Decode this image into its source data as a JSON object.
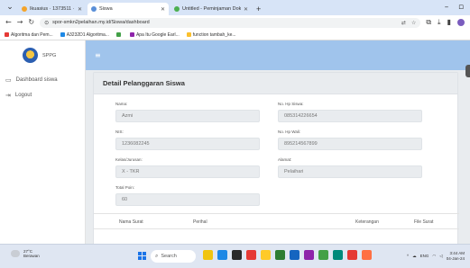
{
  "browser": {
    "tabs": [
      {
        "title": "Ikuasius · 1373511 · ids_pelat",
        "active": false,
        "favicon_color": "#f4a42b"
      },
      {
        "title": "Siswa",
        "active": true,
        "favicon_color": "#5a8fd8"
      },
      {
        "title": "Untitled - Peminjaman Dok…",
        "active": false,
        "favicon_color": "#4caf50"
      }
    ],
    "new_tab": "+",
    "url": "spor-smkn2pelaihan.my.id/Siswa/dashboard",
    "bookmarks": [
      {
        "label": "Algoritma dan Pem...",
        "color": "#e53935"
      },
      {
        "label": "A3232D1 Algoritma...",
        "color": "#1e88e5"
      },
      {
        "label": "",
        "color": "#43a047"
      },
      {
        "label": "Apa Itu Google Earl...",
        "color": "#8e24aa"
      },
      {
        "label": "function tambah_ke...",
        "color": "#fbc02d"
      }
    ]
  },
  "sidebar": {
    "brand": "SPPG",
    "items": [
      {
        "label": "Dashboard siswa",
        "icon": "monitor-icon"
      },
      {
        "label": "Logout",
        "icon": "logout-icon"
      }
    ]
  },
  "header": {
    "menu_icon": "hamburger-icon"
  },
  "card": {
    "title": "Detail Pelanggaran Siswa",
    "fields": {
      "nama": {
        "label": "Nama:",
        "value": "Azmi"
      },
      "no_hp_siswa": {
        "label": "No. Hp Siswa:",
        "value": "085314226654"
      },
      "nis": {
        "label": "NIS:",
        "value": "1236082245"
      },
      "no_hp_wali": {
        "label": "No. Hp Wali:",
        "value": "895214567899"
      },
      "kelas": {
        "label": "Kelas/Jurusan:",
        "value": "X - TKR"
      },
      "alamat": {
        "label": "Alamat:",
        "value": "Pelaihari"
      },
      "total_poin": {
        "label": "Total Poin:",
        "value": "60"
      }
    },
    "table_headers": [
      "Nama Surat",
      "Perihal",
      "Keterangan",
      "File Surat"
    ]
  },
  "taskbar": {
    "weather": {
      "temp": "27°C",
      "text": "Berawan"
    },
    "search": "Search",
    "tray_text": "ENG",
    "time": "3:44 AM",
    "date": "04-Jan-24",
    "app_colors": [
      "#f1c40f",
      "#1e88e5",
      "#2a2a2a",
      "#e53935",
      "#ffca28",
      "#2e7d32",
      "#1565c0",
      "#8e24aa",
      "#43a047",
      "#00897b",
      "#e53935",
      "#ff7043"
    ]
  }
}
